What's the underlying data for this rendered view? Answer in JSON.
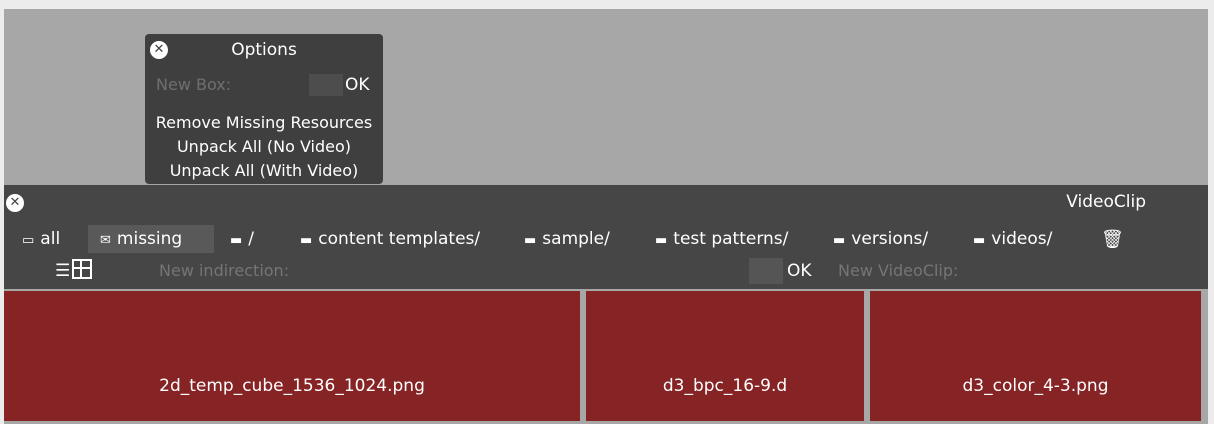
{
  "options": {
    "title": "Options",
    "new_box_label": "New Box:",
    "new_box_value": "",
    "ok_label": "OK",
    "commands": [
      "Remove Missing Resources",
      "Unpack All (No Video)",
      "Unpack All (With Video)"
    ]
  },
  "panel": {
    "title": "VideoClip",
    "tabs": [
      {
        "icon": "drive-icon",
        "label": "all"
      },
      {
        "icon": "missing-icon",
        "label": "missing"
      },
      {
        "icon": "folder-icon",
        "label": "/"
      },
      {
        "icon": "folder-icon",
        "label": "content templates/"
      },
      {
        "icon": "folder-icon",
        "label": "sample/"
      },
      {
        "icon": "folder-icon",
        "label": "test patterns/"
      },
      {
        "icon": "folder-icon",
        "label": "versions/"
      },
      {
        "icon": "folder-icon",
        "label": "videos/"
      }
    ],
    "active_tab": "missing",
    "new_indirection_label": "New indirection:",
    "ok_label": "OK",
    "new_videoclip_label": "New VideoClip:"
  },
  "clips": [
    {
      "name": "2d_temp_cube_1536_1024.png"
    },
    {
      "name": "d3_bpc_16-9.d"
    },
    {
      "name": "d3_color_4-3.png"
    }
  ],
  "colors": {
    "clip_missing": "#862325",
    "panel_bg": "#464646",
    "canvas_bg": "#a7a7a7"
  }
}
